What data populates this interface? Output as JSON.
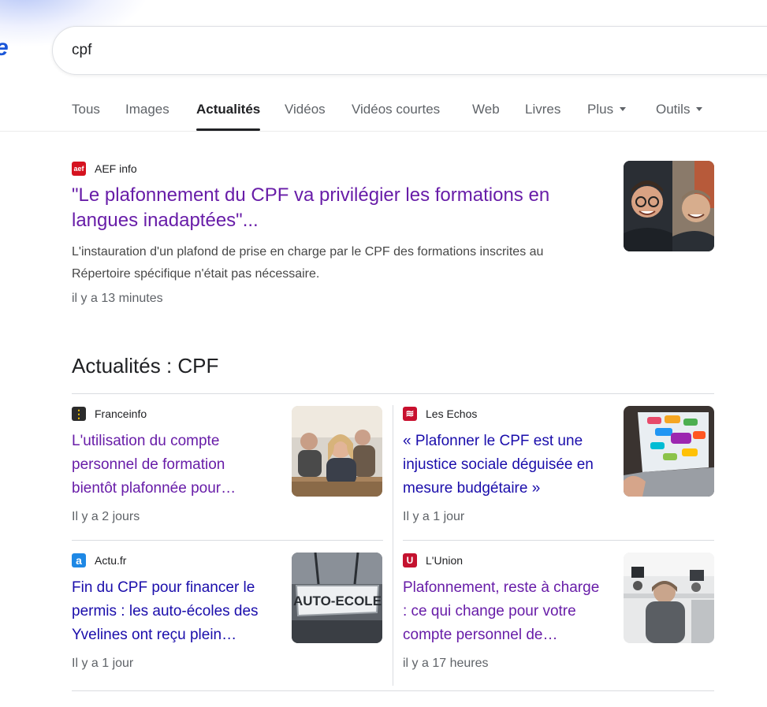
{
  "search": {
    "query": "cpf"
  },
  "logo_fragment": "e",
  "tabs": [
    {
      "label": "Tous"
    },
    {
      "label": "Images"
    },
    {
      "label": "Actualités",
      "active": true
    },
    {
      "label": "Vidéos"
    },
    {
      "label": "Vidéos courtes"
    },
    {
      "label": "Web"
    },
    {
      "label": "Livres"
    },
    {
      "label": "Plus"
    },
    {
      "label": "Outils"
    }
  ],
  "top_result": {
    "source": "AEF info",
    "favicon_text": "aef",
    "favicon_color": "#d5121f",
    "title": "\"Le plafonnement du CPF va privilégier les formations en langues inadaptées\"...",
    "snippet": "L'instauration d'un plafond de prise en charge par le CPF des formations inscrites au Répertoire spécifique n'était pas nécessaire.",
    "time": "il y a 13 minutes"
  },
  "section": {
    "title": "Actualités : CPF",
    "cards": [
      {
        "source": "Franceinfo",
        "favicon_text": "⋮",
        "favicon_color": "#2b2b2b",
        "title": "L'utilisation du compte personnel de formation bientôt plafonnée pour…",
        "time": "Il y a 2 jours",
        "visited": true
      },
      {
        "source": "Les Echos",
        "favicon_text": "≋",
        "favicon_color": "#c8102e",
        "title": "« Plafonner le CPF est une injustice sociale déguisée en mesure budgétaire »",
        "time": "Il y a 1 jour",
        "visited": false
      },
      {
        "source": "Actu.fr",
        "favicon_text": "a",
        "favicon_color": "#1e88e5",
        "title": "Fin du CPF pour financer le permis : les auto-écoles des Yvelines ont reçu plein…",
        "time": "Il y a 1 jour",
        "visited": false
      },
      {
        "source": "L'Union",
        "favicon_text": "U",
        "favicon_color": "#c4122f",
        "title": "Plafonnement, reste à charge : ce qui change pour votre compte personnel de…",
        "time": "il y a 17 heures",
        "visited": true
      }
    ]
  },
  "thumb_sign_text": "AUTO-ECOLE"
}
